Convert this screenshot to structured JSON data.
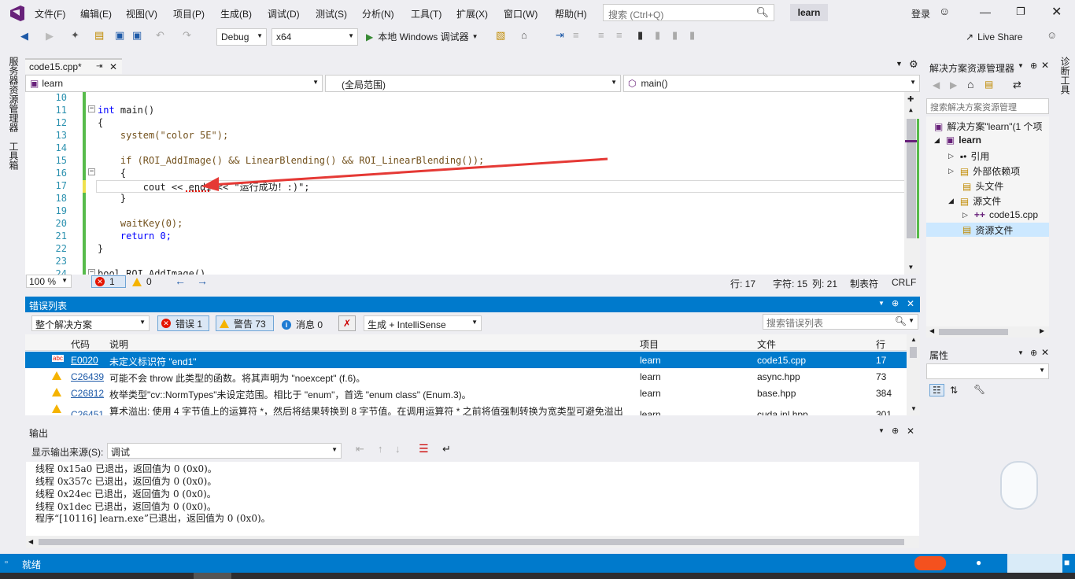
{
  "menu": {
    "items": [
      "文件(F)",
      "编辑(E)",
      "视图(V)",
      "项目(P)",
      "生成(B)",
      "调试(D)",
      "测试(S)",
      "分析(N)",
      "工具(T)",
      "扩展(X)",
      "窗口(W)",
      "帮助(H)"
    ],
    "search_placeholder": "搜索 (Ctrl+Q)",
    "solution_name": "learn",
    "login": "登录"
  },
  "toolbar": {
    "config": "Debug",
    "platform": "x64",
    "run_label": "本地 Windows 调试器",
    "live_share": "Live Share"
  },
  "left_strip": {
    "server_explorer": "服务器资源管理器",
    "toolbox": "工具箱"
  },
  "right_strip": {
    "diagnostics": "诊断工具"
  },
  "editor": {
    "tab": "code15.cpp*",
    "nav_project": "learn",
    "nav_scope": "(全局范围)",
    "nav_function": "main()",
    "lines": [
      {
        "n": "10",
        "text": ""
      },
      {
        "n": "11",
        "text": "int main()"
      },
      {
        "n": "12",
        "text": "{"
      },
      {
        "n": "13",
        "text": "    system(\"color 5E\");"
      },
      {
        "n": "14",
        "text": ""
      },
      {
        "n": "15",
        "text": "    if (ROI_AddImage() && LinearBlending() && ROI_LinearBlending());"
      },
      {
        "n": "16",
        "text": "    {"
      },
      {
        "n": "17",
        "text": "        cout << end1 << \"运行成功！:)\";"
      },
      {
        "n": "18",
        "text": "    }"
      },
      {
        "n": "19",
        "text": ""
      },
      {
        "n": "20",
        "text": "    waitKey(0);"
      },
      {
        "n": "21",
        "text": "    return 0;"
      },
      {
        "n": "22",
        "text": "}"
      },
      {
        "n": "23",
        "text": ""
      },
      {
        "n": "24",
        "text": "bool ROI_AddImage()"
      }
    ],
    "zoom": "100 %",
    "err_count": "1",
    "warn_count": "0",
    "row": "行: 17",
    "char": "字符: 15",
    "col": "列: 21",
    "tab_mode": "制表符",
    "eol": "CRLF"
  },
  "error_list": {
    "title": "错误列表",
    "scope": "整个解决方案",
    "errors_btn": "错误 1",
    "warnings_btn": "警告 73",
    "messages_btn": "消息 0",
    "build_filter": "生成 + IntelliSense",
    "search_placeholder": "搜索错误列表",
    "columns": [
      "代码",
      "说明",
      "项目",
      "文件",
      "行"
    ],
    "rows": [
      {
        "kind": "error",
        "code": "E0020",
        "desc": "未定义标识符 \"end1\"",
        "project": "learn",
        "file": "code15.cpp",
        "line": "17"
      },
      {
        "kind": "warn",
        "code": "C26439",
        "desc": "可能不会 throw 此类型的函数。将其声明为 \"noexcept\" (f.6)。",
        "project": "learn",
        "file": "async.hpp",
        "line": "73"
      },
      {
        "kind": "warn",
        "code": "C26812",
        "desc": "枚举类型\"cv::NormTypes\"未设定范围。相比于 \"enum\"，首选 \"enum class\" (Enum.3)。",
        "project": "learn",
        "file": "base.hpp",
        "line": "384"
      },
      {
        "kind": "warn",
        "code": "C26451",
        "desc": "算术溢出: 使用 4 字节值上的运算符 *，然后将结果转换到 8 字节值。在调用运算符 * 之前将值强制转换为宽类型可避免溢出",
        "project": "learn",
        "file": "cuda.inl.hpp",
        "line": "301"
      }
    ]
  },
  "output": {
    "title": "输出",
    "source_label": "显示输出来源(S):",
    "source": "调试",
    "lines": [
      "线程 0x15a0 已退出，返回值为 0 (0x0)。",
      "线程 0x357c 已退出，返回值为 0 (0x0)。",
      "线程 0x24ec 已退出，返回值为 0 (0x0)。",
      "线程 0x1dec 已退出，返回值为 0 (0x0)。",
      "程序“[10116] learn.exe”已退出，返回值为 0 (0x0)。"
    ]
  },
  "solution_explorer": {
    "title": "解决方案资源管理器",
    "search_placeholder": "搜索解决方案资源管理",
    "items": [
      {
        "label": "解决方案\"learn\"(1 个项",
        "indent": 0
      },
      {
        "label": "learn",
        "indent": 1
      },
      {
        "label": "引用",
        "indent": 2
      },
      {
        "label": "外部依赖项",
        "indent": 2
      },
      {
        "label": "头文件",
        "indent": 2
      },
      {
        "label": "源文件",
        "indent": 2
      },
      {
        "label": "code15.cpp",
        "indent": 3
      },
      {
        "label": "资源文件",
        "indent": 2
      }
    ]
  },
  "properties": {
    "title": "属性"
  },
  "status": {
    "text": "就绪"
  },
  "colors": {
    "accent": "#007acc",
    "error": "#e51400",
    "warning": "#f5b300"
  }
}
